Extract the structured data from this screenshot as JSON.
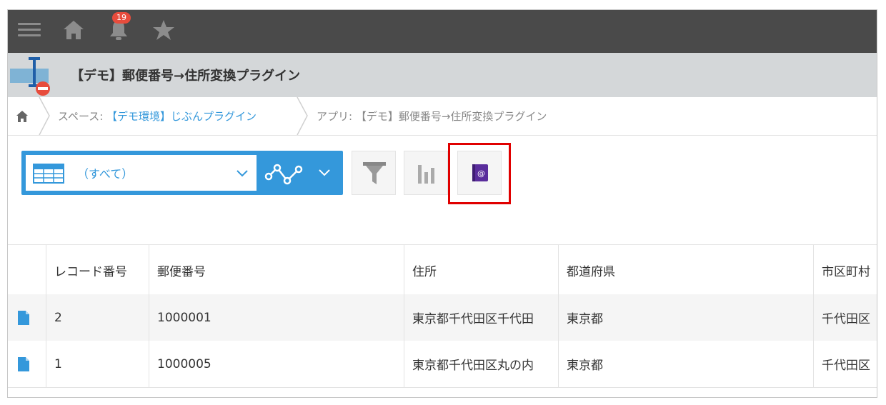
{
  "header": {
    "notification_count": "19",
    "icons": [
      "menu-icon",
      "home-icon",
      "bell-icon",
      "star-icon"
    ]
  },
  "app": {
    "title": "【デモ】郵便番号→住所変換プラグイン"
  },
  "breadcrumb": {
    "space_label": "スペース: ",
    "space_name": "【デモ環境】じぶんプラグイン",
    "app_label": "アプリ: 【デモ】郵便番号→住所変換プラグイン"
  },
  "toolbar": {
    "view_name": "（すべて）",
    "accent_color": "#3498db",
    "highlight_color": "#e00000"
  },
  "table": {
    "columns": [
      "",
      "レコード番号",
      "郵便番号",
      "住所",
      "都道府県",
      "市区町村"
    ],
    "rows": [
      {
        "record": "2",
        "zip": "1000001",
        "address": "東京都千代田区千代田",
        "pref": "東京都",
        "city": "千代田区"
      },
      {
        "record": "1",
        "zip": "1000005",
        "address": "東京都千代田区丸の内",
        "pref": "東京都",
        "city": "千代田区"
      }
    ]
  }
}
